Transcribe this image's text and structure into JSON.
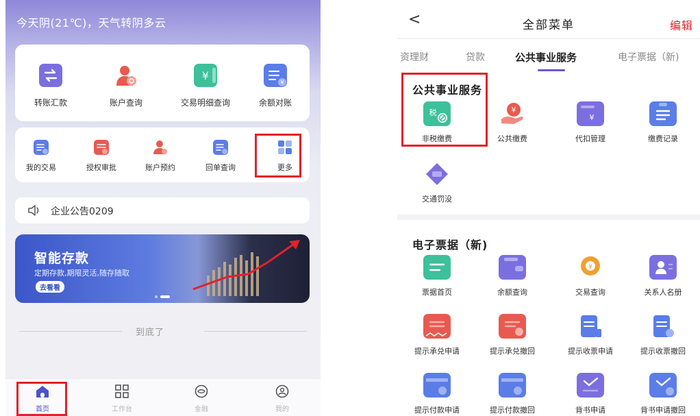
{
  "left": {
    "weather": "今天阴(21℃)，天气转阴多云",
    "quick_main": [
      {
        "label": "转账汇款",
        "icon": "transfer-icon",
        "color": "#7b6fe0"
      },
      {
        "label": "账户查询",
        "icon": "account-query-icon",
        "color": "#e85a4f"
      },
      {
        "label": "交易明细查询",
        "icon": "transaction-detail-icon",
        "color": "#3cc19a"
      },
      {
        "label": "余额对账",
        "icon": "balance-reconcile-icon",
        "color": "#5b7de8"
      }
    ],
    "quick_sub": [
      {
        "label": "我的交易",
        "icon": "my-transaction-icon",
        "color": "#5b7de8"
      },
      {
        "label": "授权审批",
        "icon": "authorization-icon",
        "color": "#e85a4f"
      },
      {
        "label": "账户预约",
        "icon": "account-reserve-icon",
        "color": "#e85a4f"
      },
      {
        "label": "回单查询",
        "icon": "receipt-query-icon",
        "color": "#5b7de8"
      },
      {
        "label": "更多",
        "icon": "more-grid-icon",
        "color": "#5b7de8"
      }
    ],
    "notice": "企业公告0209",
    "banner": {
      "title": "智能存款",
      "subtitle": "定期存款,期限灵活,随存随取",
      "button": "去看看"
    },
    "end_text": "到底了",
    "tabs": [
      {
        "label": "首页",
        "icon": "home-icon",
        "active": true
      },
      {
        "label": "工作台",
        "icon": "workbench-icon",
        "active": false
      },
      {
        "label": "金融",
        "icon": "finance-icon",
        "active": false
      },
      {
        "label": "我的",
        "icon": "profile-icon",
        "active": false
      }
    ]
  },
  "right": {
    "back": "<",
    "title": "全部菜单",
    "edit": "编辑",
    "categories": [
      {
        "label": "资理财",
        "active": false
      },
      {
        "label": "贷款",
        "active": false
      },
      {
        "label": "公共事业服务",
        "active": true
      },
      {
        "label": "电子票据（新)",
        "active": false
      }
    ],
    "section1": {
      "title": "公共事业服务",
      "items": [
        {
          "label": "非税缴费",
          "icon": "non-tax-payment-icon",
          "color": "#3cc19a"
        },
        {
          "label": "公共缴费",
          "icon": "public-payment-icon",
          "color": "#e85a4f"
        },
        {
          "label": "代扣管理",
          "icon": "withholding-icon",
          "color": "#7b6fe0"
        },
        {
          "label": "缴费记录",
          "icon": "payment-record-icon",
          "color": "#5b7de8"
        },
        {
          "label": "交通罚没",
          "icon": "traffic-fine-icon",
          "color": "#7b6fe0"
        }
      ]
    },
    "section2": {
      "title": "电子票据（新)",
      "items": [
        {
          "label": "票据首页",
          "icon": "bill-home-icon",
          "color": "#3cc19a"
        },
        {
          "label": "余额查询",
          "icon": "balance-query-icon",
          "color": "#7b6fe0"
        },
        {
          "label": "交易查询",
          "icon": "transaction-query-icon",
          "color": "#f0a030"
        },
        {
          "label": "关系人名册",
          "icon": "contacts-icon",
          "color": "#7b6fe0"
        },
        {
          "label": "提示承兑申请",
          "icon": "accept-apply-icon",
          "color": "#e85a4f"
        },
        {
          "label": "提示承兑撤回",
          "icon": "accept-withdraw-icon",
          "color": "#e85a4f"
        },
        {
          "label": "提示收票申请",
          "icon": "receive-apply-icon",
          "color": "#5b7de8"
        },
        {
          "label": "提示收票撤回",
          "icon": "receive-withdraw-icon",
          "color": "#5b7de8"
        },
        {
          "label": "提示付款申请",
          "icon": "pay-apply-icon",
          "color": "#5b7de8"
        },
        {
          "label": "提示付款撤回",
          "icon": "pay-withdraw-icon",
          "color": "#5b7de8"
        },
        {
          "label": "背书申请",
          "icon": "endorse-apply-icon",
          "color": "#7b6fe0"
        },
        {
          "label": "背书申请撤回",
          "icon": "endorse-withdraw-icon",
          "color": "#5b7de8"
        }
      ]
    }
  }
}
